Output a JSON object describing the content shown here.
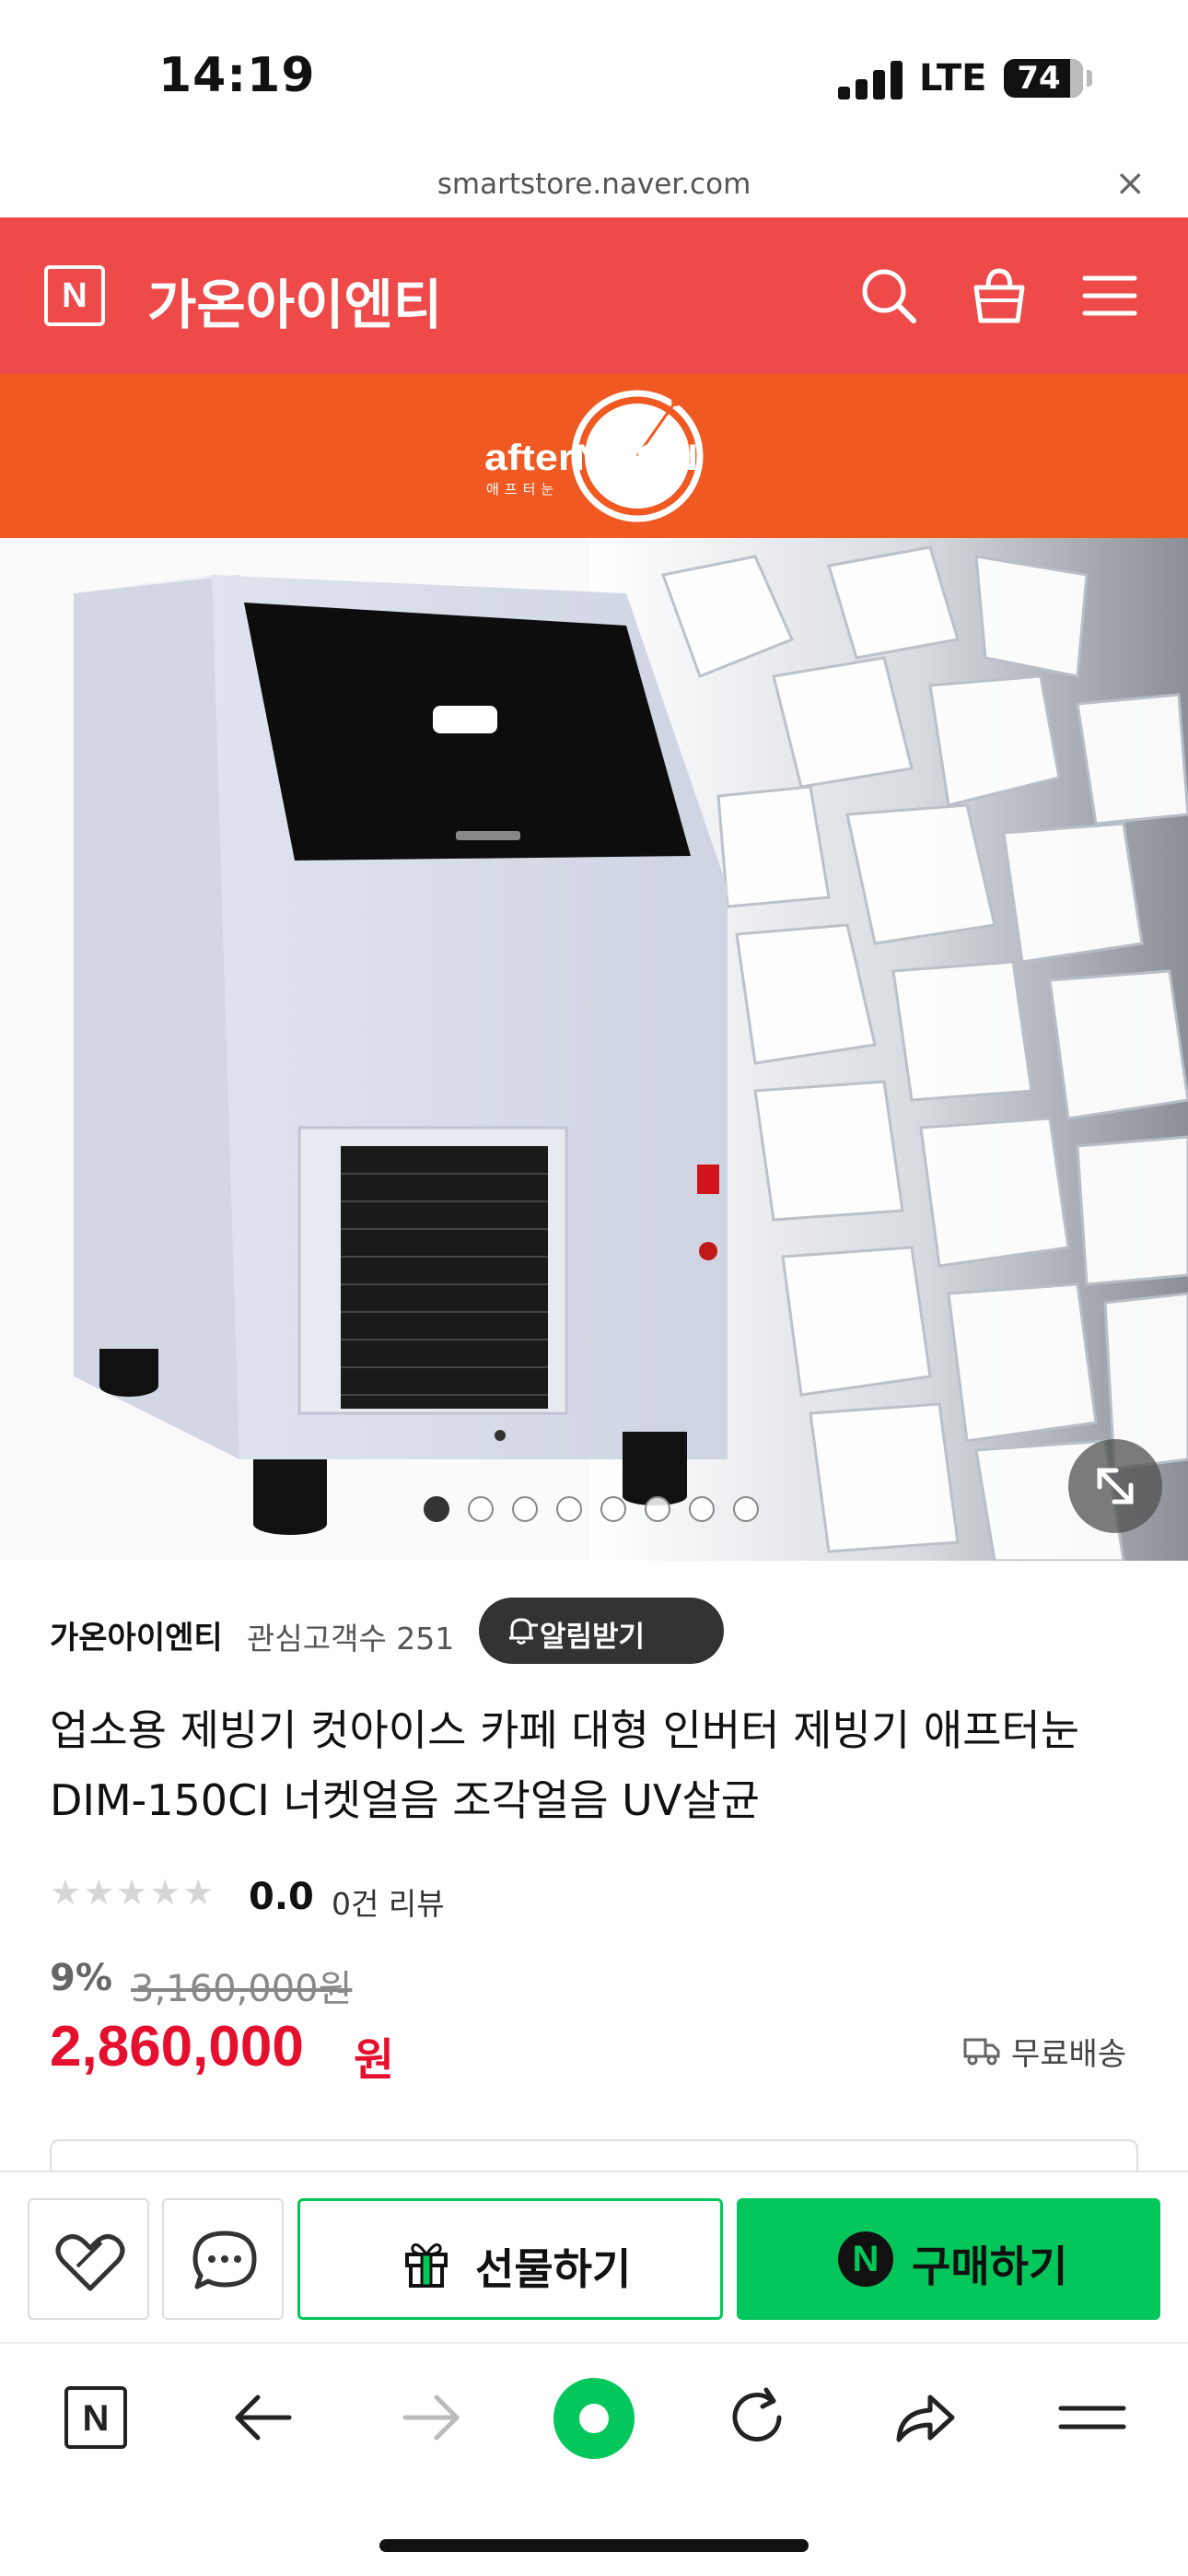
{
  "status_bar": {
    "time": "14:19",
    "network": "LTE",
    "battery": "74"
  },
  "browser": {
    "url": "smartstore.naver.com",
    "close": "×"
  },
  "header": {
    "logo_letter": "N",
    "store_name": "가온아이엔티"
  },
  "banner": {
    "brand_main": "afterNOON",
    "brand_sub": "애프터눈"
  },
  "gallery": {
    "dot_count": 8,
    "active_dot": 1
  },
  "seller": {
    "name": "가온아이엔티",
    "followers": "관심고객수 251",
    "alarm_button": "알림받기"
  },
  "product": {
    "title": "업소용 제빙기 컷아이스 카페 대형 인버터 제빙기 애프터눈 DIM-150CI 너켓얼음 조각얼음 UV살균",
    "stars": "★★★★★",
    "rating": "0.0",
    "review_count": "0건 리뷰",
    "discount": "9%",
    "original_price": "3,160,000원",
    "price": "2,860,000",
    "currency": "원",
    "shipping": "무료배송"
  },
  "actions": {
    "gift": "선물하기",
    "buy": "구매하기",
    "buy_logo": "N"
  },
  "toolbar": {
    "home_letter": "N"
  },
  "colors": {
    "header": "#ef4a4a",
    "banner": "#f05a22",
    "price": "#e5102d",
    "naver_green": "#03c75a"
  }
}
